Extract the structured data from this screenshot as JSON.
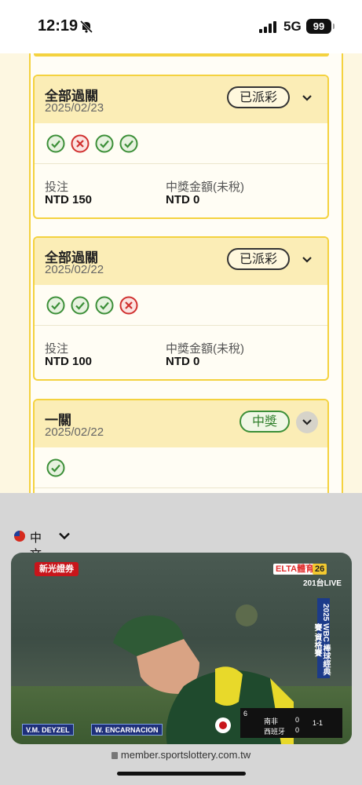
{
  "status_bar": {
    "time": "12:19",
    "network": "5G",
    "battery": "99"
  },
  "bets": [
    {
      "type": "全部過關",
      "date": "2025/02/23",
      "status": "已派彩",
      "status_kind": "paid",
      "picks": [
        "win",
        "loss",
        "win",
        "win"
      ],
      "stake_label": "投注",
      "stake_value": "NTD 150",
      "prize_label": "中獎金額(未稅)",
      "prize_value": "NTD 0"
    },
    {
      "type": "全部過關",
      "date": "2025/02/22",
      "status": "已派彩",
      "status_kind": "paid",
      "picks": [
        "win",
        "win",
        "win",
        "loss"
      ],
      "stake_label": "投注",
      "stake_value": "NTD 100",
      "prize_label": "中獎金額(未稅)",
      "prize_value": "NTD 0"
    },
    {
      "type": "一關",
      "date": "2025/02/22",
      "status": "中獎",
      "status_kind": "won",
      "picks": [
        "win"
      ]
    }
  ],
  "language": {
    "label": "中文"
  },
  "video": {
    "sponsor": "新光證券",
    "network_logo": "ELTA體育",
    "channel": "26",
    "live_text": "201台LIVE",
    "side_banner": "2025 WBC 棒球經典賽 資格賽",
    "player_left": "V.M. DEYZEL",
    "player_right": "W. ENCARNACION",
    "score_team1": "南非",
    "score_team2": "西班牙",
    "score1": "0",
    "score2": "0",
    "inning": "6",
    "count": "1-1"
  },
  "browser": {
    "url": "member.sportslottery.com.tw"
  },
  "colors": {
    "accent": "#f4d23f",
    "win": "#3c8f38",
    "loss": "#d0302f"
  }
}
